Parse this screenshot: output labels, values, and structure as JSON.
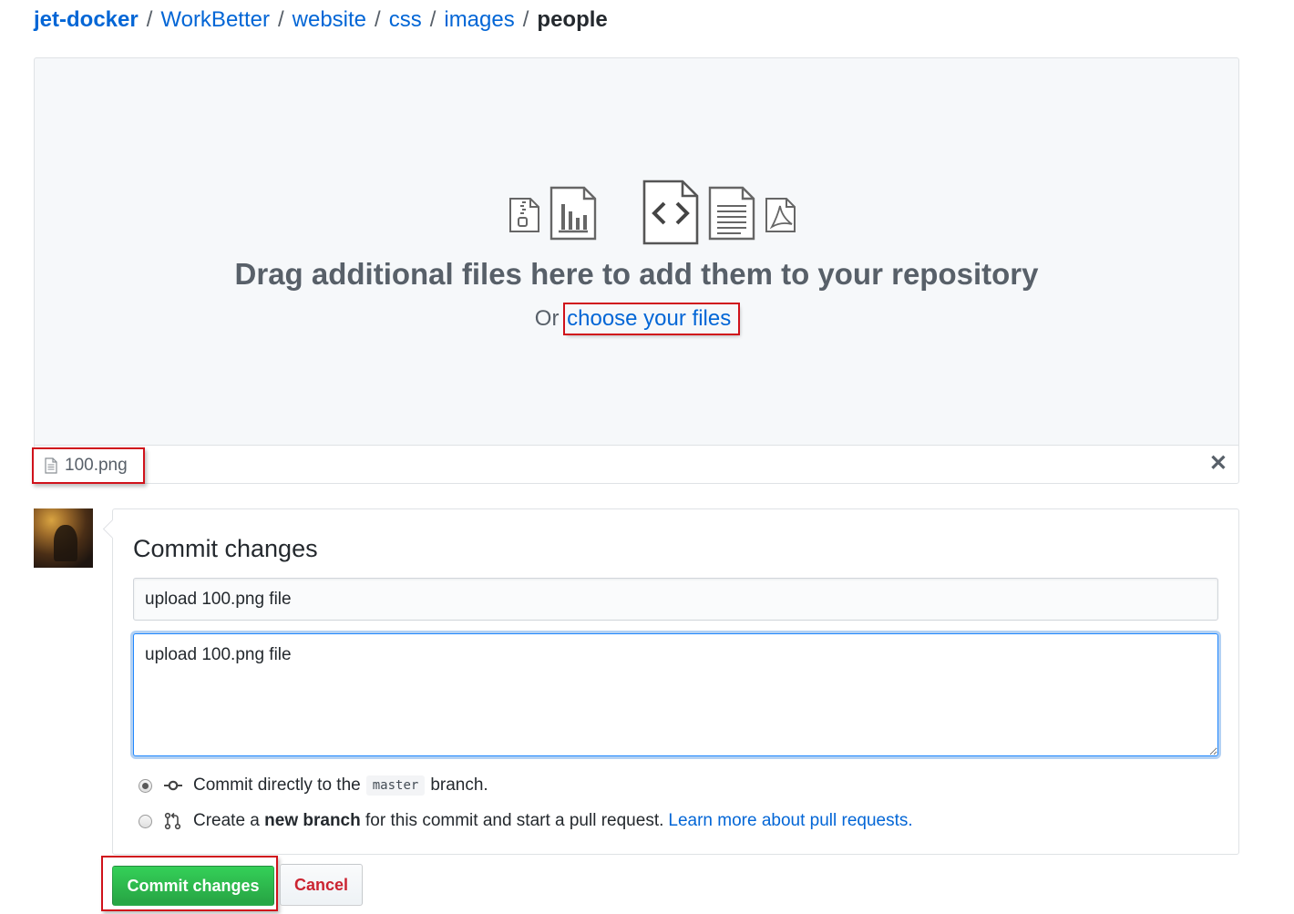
{
  "breadcrumb": {
    "owner": "jet-docker",
    "items": [
      "WorkBetter",
      "website",
      "css",
      "images"
    ],
    "current": "people",
    "separator": "/"
  },
  "dropzone": {
    "icons": [
      "zip-file-icon",
      "chart-file-icon",
      "code-file-icon",
      "text-file-icon",
      "pdf-file-icon"
    ],
    "title": "Drag additional files here to add them to your repository",
    "or_text": "Or",
    "choose_link": "choose your files"
  },
  "uploaded_file": {
    "name": "100.png",
    "remove_symbol": "✕"
  },
  "commit": {
    "title": "Commit changes",
    "summary_value": "upload 100.png file",
    "description_value": "upload 100.png file",
    "option_direct": {
      "prefix": "Commit directly to the",
      "branch": "master",
      "suffix": "branch.",
      "checked": true
    },
    "option_new_branch": {
      "prefix": "Create a",
      "bold": "new branch",
      "suffix": "for this commit and start a pull request.",
      "link": "Learn more about pull requests.",
      "checked": false
    },
    "commit_button": "Commit changes",
    "cancel_button": "Cancel"
  },
  "colors": {
    "link": "#0366d6",
    "commit_green": "#28a745",
    "cancel_red": "#cb2431",
    "highlight_box": "#d0121b"
  }
}
